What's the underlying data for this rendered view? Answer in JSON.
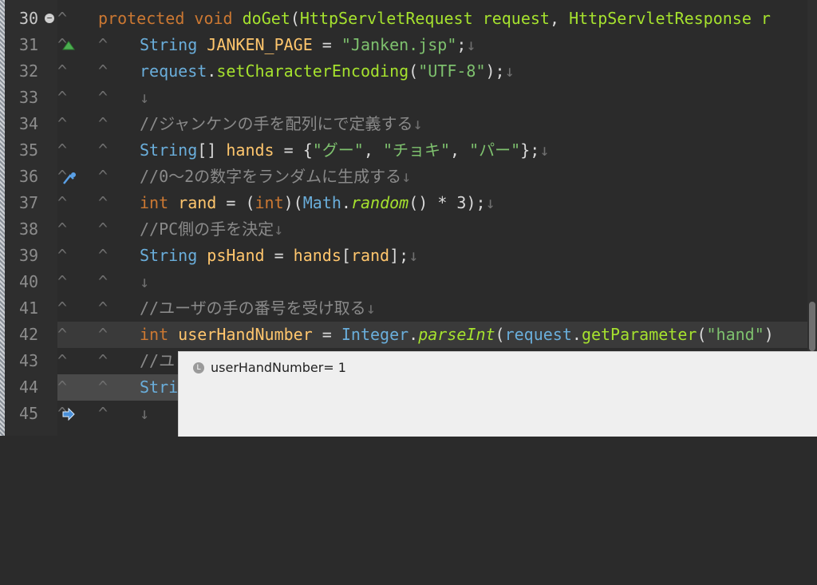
{
  "lines": [
    {
      "num": "30",
      "text": "protected void doGet(HttpServletRequest request, HttpServletResponse r"
    },
    {
      "num": "31",
      "text": "String JANKEN_PAGE = \"Janken.jsp\";"
    },
    {
      "num": "32",
      "text": "request.setCharacterEncoding(\"UTF-8\");"
    },
    {
      "num": "33",
      "text": ""
    },
    {
      "num": "34",
      "text": "//ジャンケンの手を配列にで定義する"
    },
    {
      "num": "35",
      "text": "String[] hands = {\"グー\", \"チョキ\", \"パー\"};"
    },
    {
      "num": "36",
      "text": "//0〜2の数字をランダムに生成する"
    },
    {
      "num": "37",
      "text": "int rand = (int)(Math.random() * 3);"
    },
    {
      "num": "38",
      "text": "//PC側の手を決定"
    },
    {
      "num": "39",
      "text": "String psHand = hands[rand];"
    },
    {
      "num": "40",
      "text": ""
    },
    {
      "num": "41",
      "text": "//ユーザの手の番号を受け取る"
    },
    {
      "num": "42",
      "text": "int userHandNumber = Integer.parseInt(request.getParameter(\"hand\")"
    },
    {
      "num": "43",
      "text": "//ユ"
    },
    {
      "num": "44",
      "text": "Stri"
    },
    {
      "num": "45",
      "text": ""
    }
  ],
  "whitespace": {
    "tab": "^",
    "newline": "↓"
  },
  "tooltip": {
    "label": "userHandNumber= 1"
  },
  "colors": {
    "background": "#2b2b2b",
    "keyword": "#cc7832",
    "type": "#6aaedb",
    "string": "#7ec16e",
    "comment": "#8a8a8a"
  }
}
